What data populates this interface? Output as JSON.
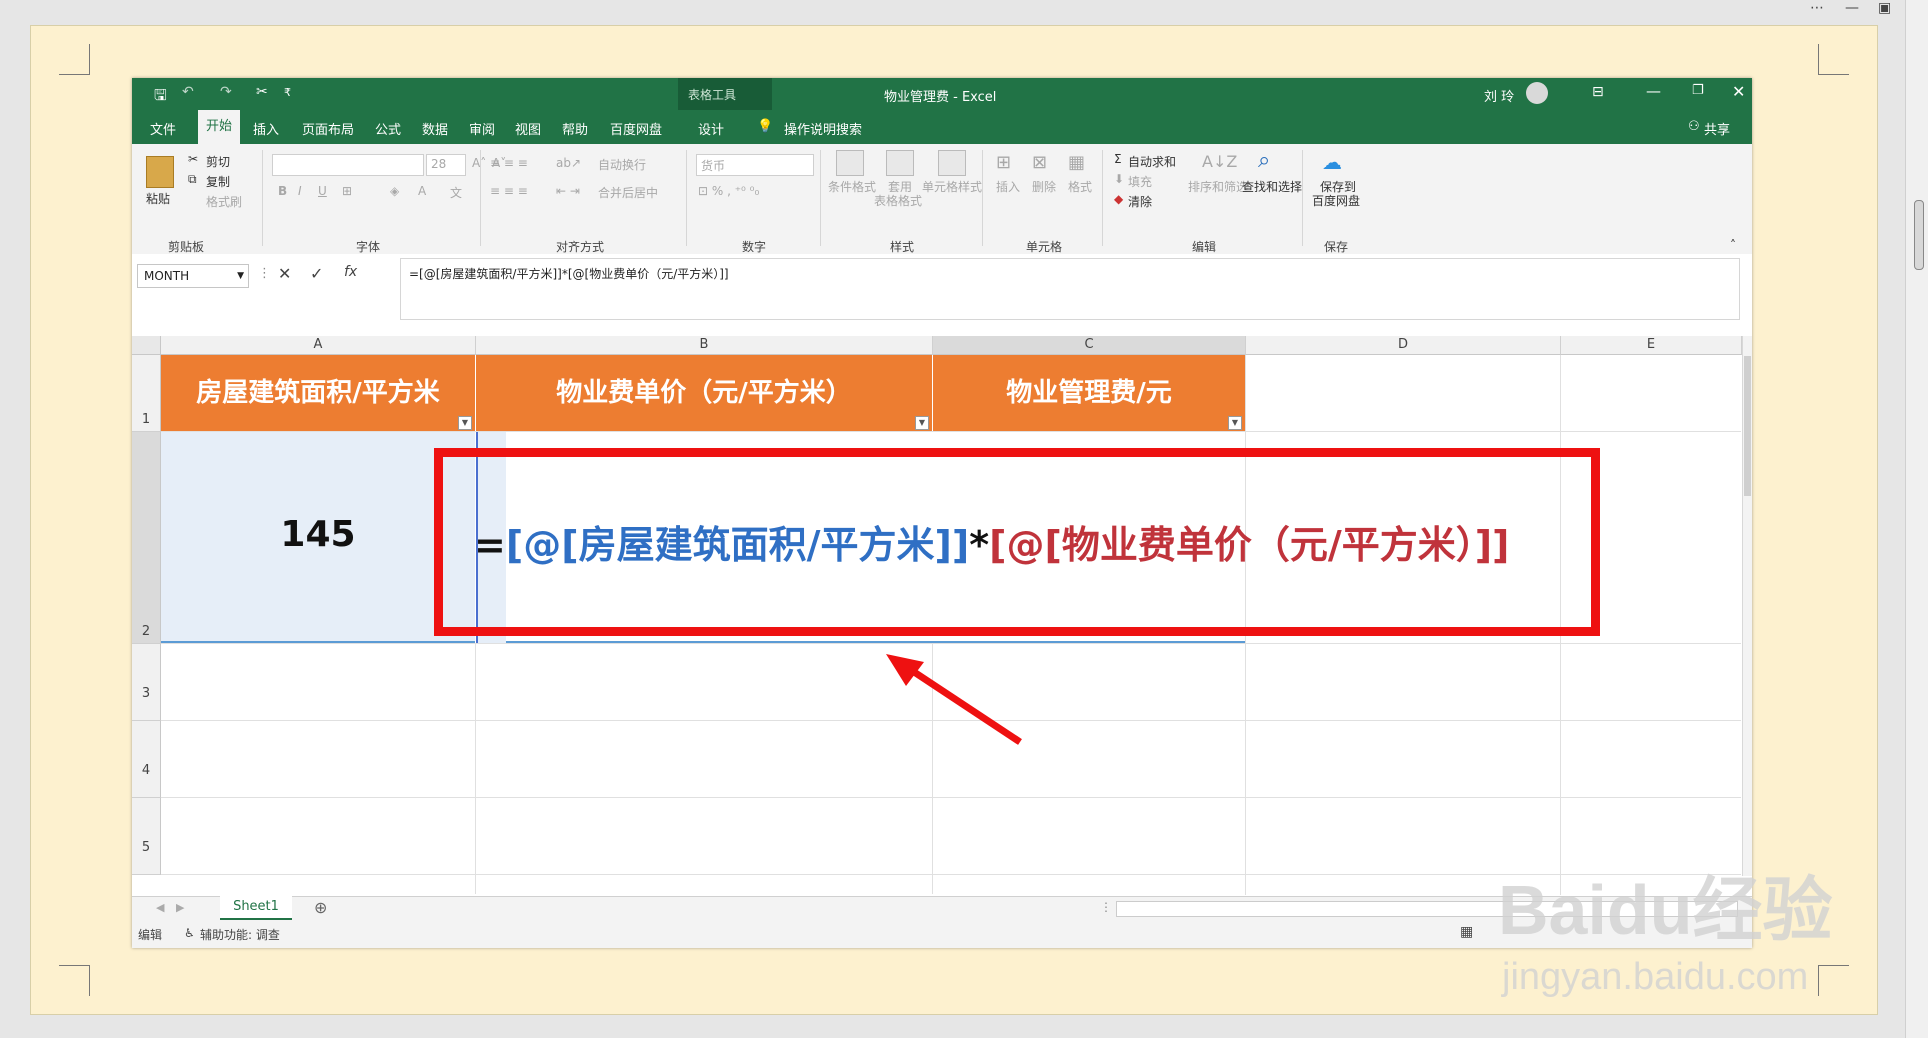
{
  "titlebar": {
    "qat_more": "₹",
    "context_tools": "表格工具",
    "title": "物业管理费 - Excel",
    "user": "刘 玲"
  },
  "tabs": [
    "文件",
    "开始",
    "插入",
    "页面布局",
    "公式",
    "数据",
    "审阅",
    "视图",
    "帮助",
    "百度网盘",
    "设计"
  ],
  "tell_me": "操作说明搜索",
  "share": "共享",
  "ribbon": {
    "clipboard": {
      "paste": "粘贴",
      "cut": "剪切",
      "copy": "复制",
      "format_painter": "格式刷",
      "label": "剪贴板"
    },
    "font": {
      "size": "28",
      "label": "字体",
      "bold": "B",
      "italic": "I",
      "underline": "U"
    },
    "alignment": {
      "wrap": "自动换行",
      "merge": "合并后居中",
      "label": "对齐方式"
    },
    "number": {
      "format": "货币",
      "label": "数字"
    },
    "styles": {
      "conditional": "条件格式",
      "table_format_1": "套用",
      "table_format_2": "表格格式",
      "cell_styles": "单元格样式",
      "label": "样式"
    },
    "cells": {
      "insert": "插入",
      "delete": "删除",
      "format": "格式",
      "label": "单元格"
    },
    "editing": {
      "autosum": "自动求和",
      "fill": "填充",
      "clear": "清除",
      "sort": "排序和筛选",
      "find": "查找和选择",
      "label": "编辑"
    },
    "save": {
      "line1": "保存到",
      "line2": "百度网盘",
      "label": "保存"
    }
  },
  "formula_bar": {
    "name_box": "MONTH",
    "fx": "fx",
    "formula": "=[@[房屋建筑面积/平方米]]*[@[物业费单价（元/平方米）]]"
  },
  "columns": [
    "A",
    "B",
    "C",
    "D",
    "E"
  ],
  "rows": [
    "1",
    "2",
    "3",
    "4",
    "5"
  ],
  "header_cells": [
    "房屋建筑面积/平方米",
    "物业费单价（元/平方米）",
    "物业管理费/元"
  ],
  "cell_a2": "145",
  "formula_overlay": {
    "eq": "=",
    "ref1": "[@[房屋建筑面积/平方米]]",
    "op": "*",
    "ref2": "[@[物业费单价（元/平方米）]]"
  },
  "sheet_tab": "Sheet1",
  "status": {
    "mode": "编辑",
    "accessibility": "辅助功能: 调查"
  },
  "watermark": {
    "brand": "Baidu经验",
    "url": "jingyan.baidu.com"
  },
  "colors": {
    "excel_green": "#217346",
    "header_orange": "#ed7d31",
    "ref_blue": "#2f6fc4",
    "ref_red": "#c0333b",
    "annotation_red": "#ee1111",
    "paper": "#fdf1cf"
  }
}
